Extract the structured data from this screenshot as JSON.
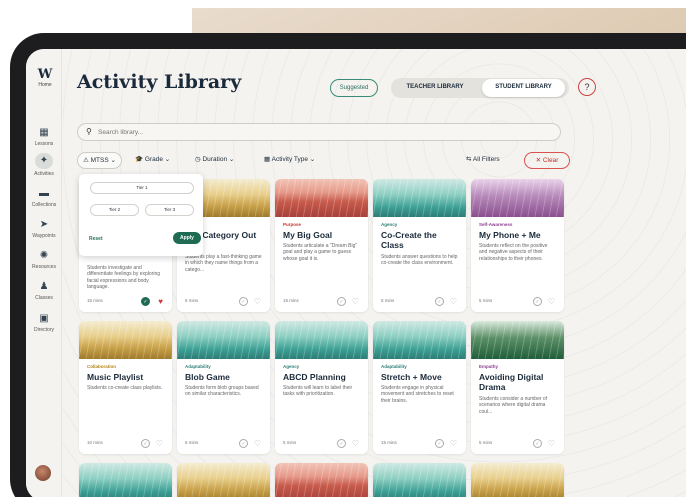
{
  "sidebar": {
    "logo": "W",
    "logo_sub": "Home",
    "items": [
      {
        "label": "Lessons",
        "icon": "lessons-icon",
        "glyph": "▦"
      },
      {
        "label": "Activities",
        "icon": "activities-icon",
        "glyph": "✦"
      },
      {
        "label": "Collections",
        "icon": "folder-icon",
        "glyph": "▬"
      },
      {
        "label": "Waypoints",
        "icon": "waypoint-icon",
        "glyph": "➤"
      },
      {
        "label": "Resources",
        "icon": "resources-icon",
        "glyph": "✺"
      },
      {
        "label": "Classes",
        "icon": "classes-icon",
        "glyph": "♟"
      },
      {
        "label": "Directory",
        "icon": "directory-icon",
        "glyph": "▣"
      }
    ]
  },
  "header": {
    "title": "Activity Library",
    "suggested": "Suggested",
    "teacher_library": "TEACHER LIBRARY",
    "student_library": "STUDENT LIBRARY",
    "help": "?"
  },
  "search": {
    "placeholder": "Search library..."
  },
  "filters": {
    "mtss": "MTSS",
    "grade": "Grade",
    "duration": "Duration",
    "activity_type": "Activity Type",
    "all_filters": "All Filters",
    "clear": "Clear"
  },
  "mtss_dropdown": {
    "tier1": "Tier 1",
    "tier2": "Tier 2",
    "tier3": "Tier 3",
    "reset": "Reset",
    "apply": "Apply"
  },
  "cards_row1": [
    {
      "category": "",
      "title": "",
      "desc": "Students investigate and differentiate feelings by exploring facial expressions and body language.",
      "mins": "15 mins",
      "done": true,
      "fav": true
    },
    {
      "category": "ce",
      "title": "ory, Category Out",
      "desc": "Students play a fast-thinking game in which they name things from a catego...",
      "mins": "5 mins",
      "done": false,
      "fav": false
    },
    {
      "category": "Purpose",
      "title": "My Big Goal",
      "desc": "Students articulate a \"Dream Big\" goal and play a game to guess whose goal it is.",
      "mins": "15 mins",
      "done": false,
      "fav": false
    },
    {
      "category": "Agency",
      "title": "Co-Create the Class",
      "desc": "Students answer questions to help co-create the class environment.",
      "mins": "5 mins",
      "done": false,
      "fav": false
    },
    {
      "category": "Self-Awareness",
      "title": "My Phone + Me",
      "desc": "Students reflect on the positive and negative aspects of their relationships to their phones.",
      "mins": "5 mins",
      "done": false,
      "fav": false
    }
  ],
  "cards_row2": [
    {
      "category": "Collaboration",
      "title": "Music Playlist",
      "desc": "Students co-create class playlists.",
      "mins": "10 mins",
      "done": false,
      "fav": false
    },
    {
      "category": "Adaptability",
      "title": "Blob Game",
      "desc": "Students form blob groups based on similar characteristics.",
      "mins": "5 mins",
      "done": false,
      "fav": false
    },
    {
      "category": "Agency",
      "title": "ABCD Planning",
      "desc": "Students will learn to label their tasks with prioritization.",
      "mins": "5 mins",
      "done": false,
      "fav": false
    },
    {
      "category": "Adaptability",
      "title": "Stretch + Move",
      "desc": "Students engage in physical movement and stretches to reset their brains.",
      "mins": "15 mins",
      "done": false,
      "fav": false
    },
    {
      "category": "Empathy",
      "title": "Avoiding Digital Drama",
      "desc": "Students consider a number of scenarios where digital drama coul...",
      "mins": "5 mins",
      "done": false,
      "fav": false
    }
  ],
  "colors": {
    "accent_green": "#1f6b54",
    "clear_red": "#c9302c",
    "navy": "#1b2a3a"
  }
}
